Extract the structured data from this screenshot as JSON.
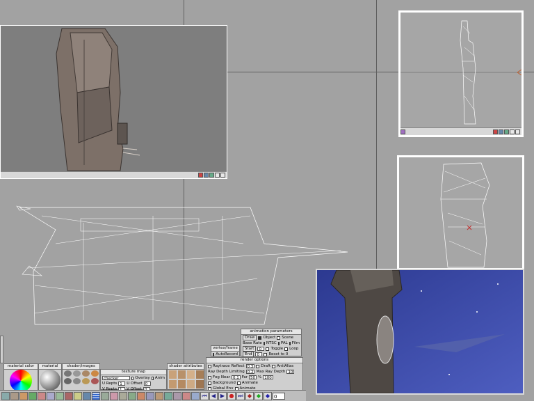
{
  "viewports": {
    "textured_view": {
      "label": "textured-perspective"
    },
    "top_right": {
      "label": "side"
    },
    "front_right": {
      "label": "front"
    },
    "render": {
      "label": "render-preview"
    }
  },
  "animation_parameters": {
    "title": "animation parameters",
    "draw_label": "Draw",
    "draw_object": "Object",
    "draw_scene": "Scene",
    "base_rate_label": "Base Rate",
    "rate_ntsc": "NTSC",
    "rate_pal": "PAL",
    "rate_film": "Film",
    "start_label": "Start",
    "start_value": "0",
    "toggle_label": "Toggle",
    "loop_label": "Loop",
    "end_label": "End",
    "end_value": "0",
    "reset_label": "Reset to 0"
  },
  "vertex_frame": {
    "title": "vertex/frame",
    "autorecord": "AutoRecord"
  },
  "render_options": {
    "title": "render options",
    "raytrace": "Raytrace",
    "reflect_label": "Reflect",
    "reflect_value": "0.3",
    "draft": "Draft",
    "antialias": "AntiAlias",
    "ray_depth_limiting": "Ray Depth Limiting",
    "ray_depth_value": "0.2",
    "max_ray_depth_label": "Max Ray Depth",
    "max_ray_depth_value": "10",
    "fog": "Fog",
    "near_label": "Near",
    "near_value": "0.1",
    "far_label": "Far",
    "far_value": "50",
    "pct_label": "%",
    "pct_value": "100",
    "background": "Background",
    "animate1": "Animate",
    "global_env": "Global Env",
    "animate2": "Animate"
  },
  "texture_map": {
    "title": "texture map",
    "name": "checker",
    "overlay": "Overlay",
    "anim": "Anim",
    "u_repts_label": "U Repts",
    "u_repts_value": "1",
    "u_offset_label": "U Offset",
    "u_offset_value": "0",
    "v_repts_label": "V Repts",
    "v_repts_value": "1",
    "v_offset_label": "V Offset",
    "v_offset_value": "0"
  },
  "panels": {
    "material_color": "material color",
    "material": "material",
    "shader_images": "shader/images",
    "shader_attributes": "shader attributes"
  },
  "frame_field": {
    "value": "0"
  },
  "colors": {
    "background": "#a2a2a2",
    "render_sky": "#3b4aa8",
    "viewport_border": "#ffffff"
  }
}
